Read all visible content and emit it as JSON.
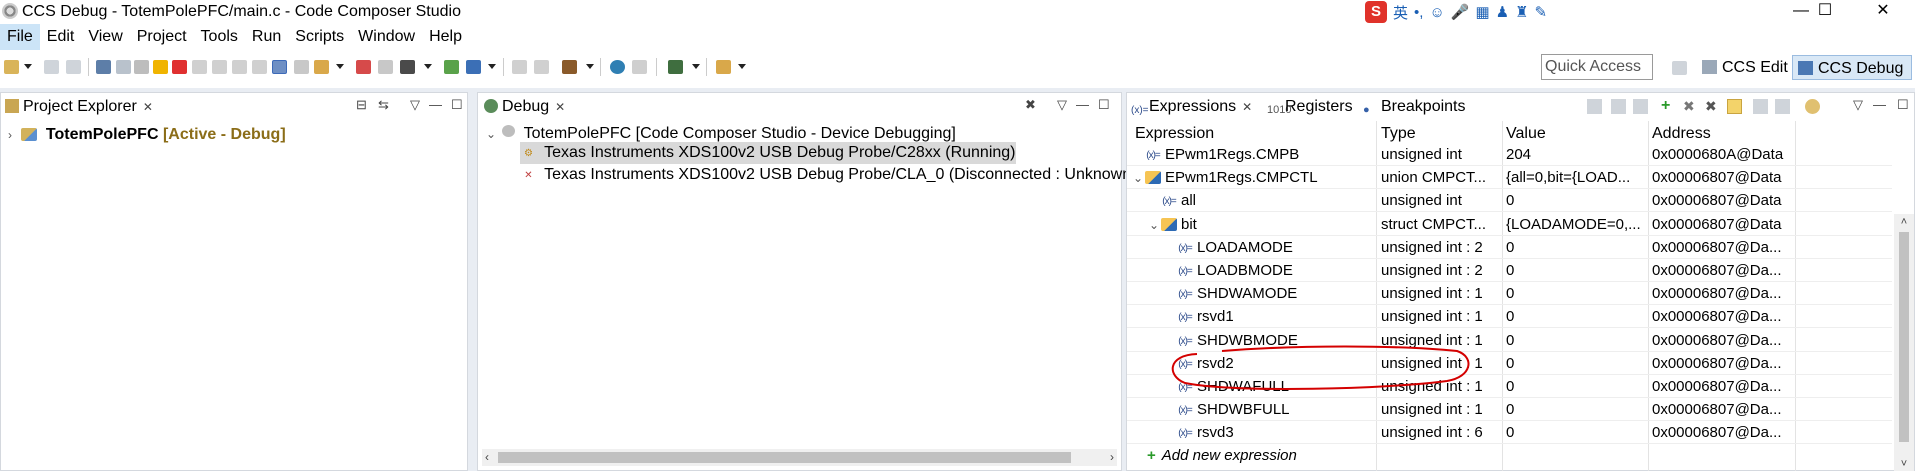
{
  "window": {
    "title": "CCS Debug - TotemPolePFC/main.c - Code Composer Studio",
    "controls": {
      "minimize": "—",
      "maximize": "☐",
      "close": "✕"
    },
    "ime": {
      "logo": "S",
      "mode": "英"
    }
  },
  "menu": [
    "File",
    "Edit",
    "View",
    "Project",
    "Tools",
    "Run",
    "Scripts",
    "Window",
    "Help"
  ],
  "toolbar": {
    "quick_access_placeholder": "Quick Access",
    "perspectives": [
      {
        "label": "CCS Edit",
        "active": false
      },
      {
        "label": "CCS Debug",
        "active": true
      }
    ]
  },
  "project_explorer": {
    "tab": "Project Explorer",
    "items": [
      {
        "name": "TotemPolePFC",
        "status": "[Active - Debug]",
        "status_color": "#8b6d18"
      }
    ]
  },
  "debug": {
    "tab": "Debug",
    "session": "TotemPolePFC [Code Composer Studio - Device Debugging]",
    "targets": [
      {
        "label": "Texas Instruments XDS100v2 USB Debug Probe/C28xx (Running)",
        "selected": true
      },
      {
        "label": "Texas Instruments XDS100v2 USB Debug Probe/CLA_0 (Disconnected : Unknown",
        "selected": false
      }
    ]
  },
  "expressions": {
    "tabs": [
      "Expressions",
      "Registers",
      "Breakpoints"
    ],
    "columns": [
      "Expression",
      "Type",
      "Value",
      "Address"
    ],
    "rows": [
      {
        "expr": "EPwm1Regs.CMPB",
        "type": "unsigned int",
        "value": "204",
        "address": "0x0000680A@Data",
        "level": 0,
        "twisty": "",
        "icon": "var"
      },
      {
        "expr": "EPwm1Regs.CMPCTL",
        "type": "union CMPCT...",
        "value": "{all=0,bit={LOAD...",
        "address": "0x00006807@Data",
        "level": 0,
        "twisty": "⌄",
        "icon": "struct"
      },
      {
        "expr": "all",
        "type": "unsigned int",
        "value": "0",
        "address": "0x00006807@Data",
        "level": 1,
        "twisty": "",
        "icon": "var"
      },
      {
        "expr": "bit",
        "type": "struct CMPCT...",
        "value": "{LOADAMODE=0,...",
        "address": "0x00006807@Data",
        "level": 1,
        "twisty": "⌄",
        "icon": "struct"
      },
      {
        "expr": "LOADAMODE",
        "type": "unsigned int : 2",
        "value": "0",
        "address": "0x00006807@Da...",
        "level": 2,
        "twisty": "",
        "icon": "var"
      },
      {
        "expr": "LOADBMODE",
        "type": "unsigned int : 2",
        "value": "0",
        "address": "0x00006807@Da...",
        "level": 2,
        "twisty": "",
        "icon": "var"
      },
      {
        "expr": "SHDWAMODE",
        "type": "unsigned int : 1",
        "value": "0",
        "address": "0x00006807@Da...",
        "level": 2,
        "twisty": "",
        "icon": "var"
      },
      {
        "expr": "rsvd1",
        "type": "unsigned int : 1",
        "value": "0",
        "address": "0x00006807@Da...",
        "level": 2,
        "twisty": "",
        "icon": "var"
      },
      {
        "expr": "SHDWBMODE",
        "type": "unsigned int : 1",
        "value": "0",
        "address": "0x00006807@Da...",
        "level": 2,
        "twisty": "",
        "icon": "var",
        "circled": true
      },
      {
        "expr": "rsvd2",
        "type": "unsigned int : 1",
        "value": "0",
        "address": "0x00006807@Da...",
        "level": 2,
        "twisty": "",
        "icon": "var"
      },
      {
        "expr": "SHDWAFULL",
        "type": "unsigned int : 1",
        "value": "0",
        "address": "0x00006807@Da...",
        "level": 2,
        "twisty": "",
        "icon": "var"
      },
      {
        "expr": "SHDWBFULL",
        "type": "unsigned int : 1",
        "value": "0",
        "address": "0x00006807@Da...",
        "level": 2,
        "twisty": "",
        "icon": "var"
      },
      {
        "expr": "rsvd3",
        "type": "unsigned int : 6",
        "value": "0",
        "address": "0x00006807@Da...",
        "level": 2,
        "twisty": "",
        "icon": "var"
      }
    ],
    "add_new": "Add new expression",
    "annotation_color": "#d40000"
  }
}
